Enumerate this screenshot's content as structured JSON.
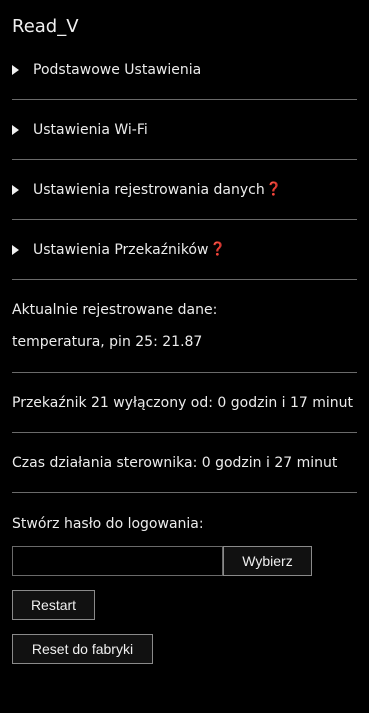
{
  "app": {
    "title": "Read_V"
  },
  "sections": [
    {
      "label": "Podstawowe Ustawienia",
      "hint": ""
    },
    {
      "label": "Ustawienia Wi-Fi",
      "hint": ""
    },
    {
      "label": "Ustawienia rejestrowania danych",
      "hint": "❓"
    },
    {
      "label": "Ustawienia Przekaźników",
      "hint": "❓"
    }
  ],
  "logging": {
    "heading": "Aktualnie rejestrowane dane:",
    "value": "temperatura, pin 25: 21.87"
  },
  "relay": {
    "status": "Przekaźnik 21 wyłączony od: 0 godzin i 17 minut"
  },
  "uptime": {
    "text": "Czas działania sterownika: 0 godzin i 27 minut"
  },
  "password": {
    "heading": "Stwórz hasło do logowania:",
    "value": "",
    "placeholder": "",
    "choose_label": "Wybierz"
  },
  "actions": {
    "restart_label": "Restart",
    "factory_reset_label": "Reset do fabryki"
  },
  "colors": {
    "background": "#000000",
    "text": "#ececec",
    "divider": "#6a6a6a",
    "hint": "#e03030"
  }
}
